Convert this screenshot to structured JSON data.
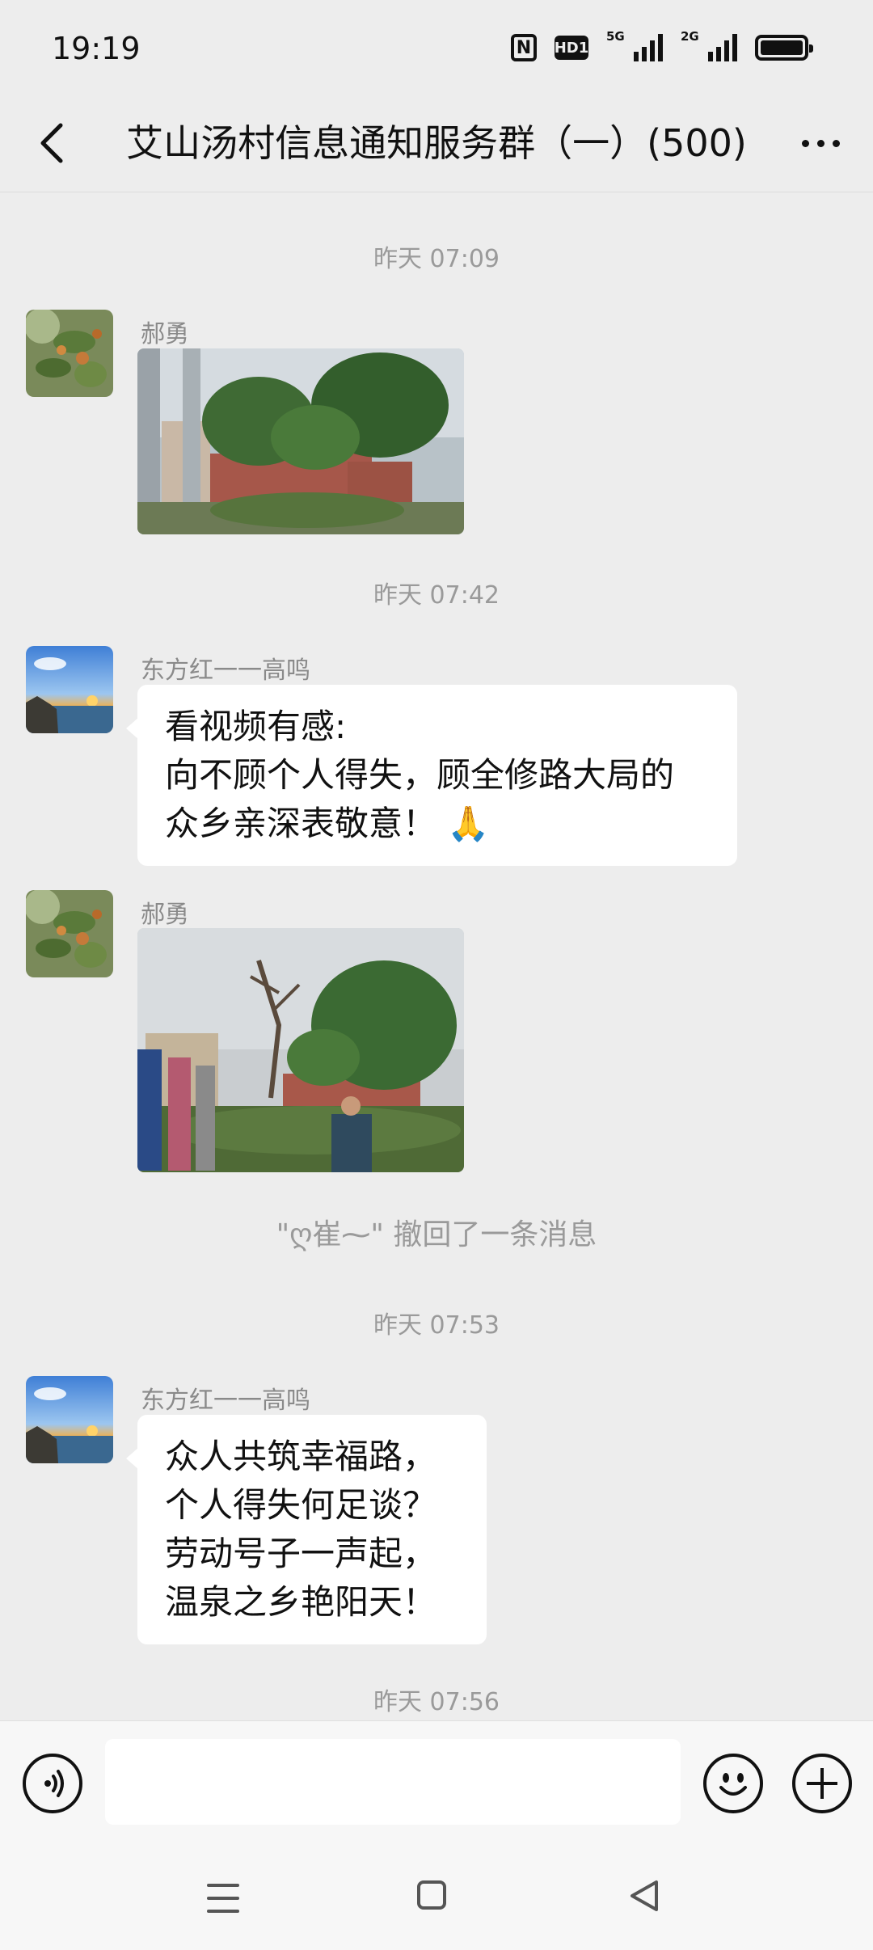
{
  "status": {
    "time": "19:19",
    "hd_label": "HD1",
    "sig1_label": "5G",
    "sig2_label": "2G"
  },
  "header": {
    "title": "艾山汤村信息通知服务群（一）(500)"
  },
  "messages": {
    "t1": "昨天 07:09",
    "m1_sender": "郝勇",
    "t2": "昨天 07:42",
    "m2_sender": "东方红一一高鸣",
    "m2_text": "看视频有感:\n向不顾个人得失，顾全修路大局的\n众乡亲深表敬意！ 🙏",
    "m3_sender": "郝勇",
    "recall": "\"ღ崔⁓\" 撤回了一条消息",
    "t3": "昨天 07:53",
    "m4_sender": "东方红一一高鸣",
    "m4_text": "众人共筑幸福路，\n个人得失何足谈？\n劳动号子一声起，\n温泉之乡艳阳天！",
    "t4": "昨天 07:56"
  },
  "input": {
    "value": ""
  },
  "colors": {
    "background": "#ededed",
    "bubble": "#ffffff",
    "meta_text": "#9a9a9a"
  }
}
